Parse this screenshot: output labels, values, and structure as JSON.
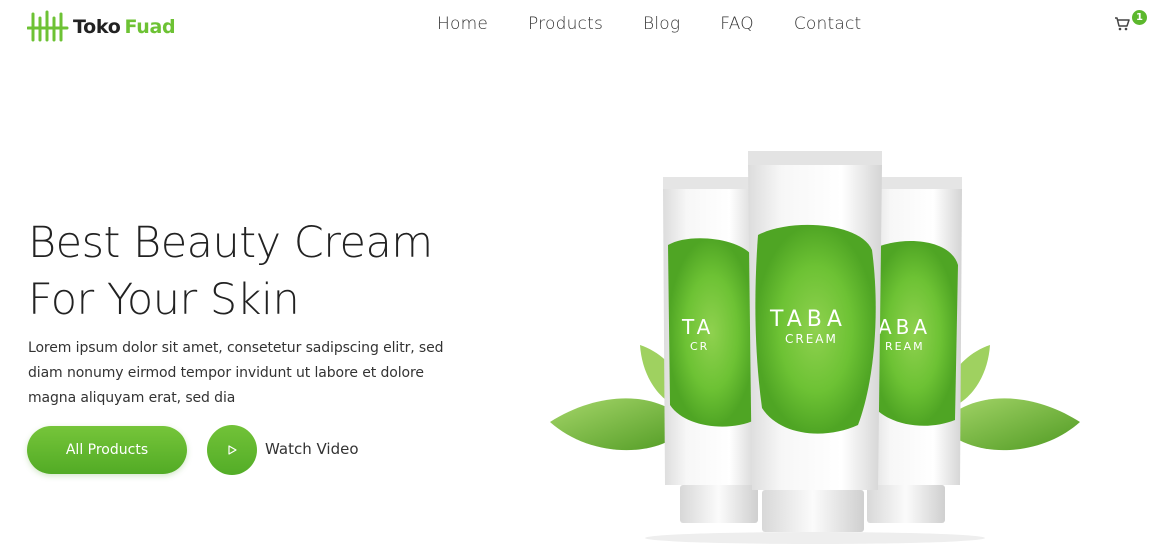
{
  "header": {
    "logo": {
      "part1": "Toko",
      "part2": "Fuad",
      "icon": "bars-logo-icon"
    },
    "nav": [
      {
        "label": "Home"
      },
      {
        "label": "Products"
      },
      {
        "label": "Blog"
      },
      {
        "label": "FAQ"
      },
      {
        "label": "Contact"
      }
    ],
    "cart": {
      "icon": "cart-icon",
      "count": "1"
    }
  },
  "hero": {
    "title_line1": "Best Beauty Cream",
    "title_line2": "For Your Skin",
    "description": "Lorem ipsum dolor sit amet, consetetur sadipscing elitr, sed diam nonumy eirmod tempor invidunt ut labore et dolore magna aliquyam erat, sed dia",
    "primary_button": "All Products",
    "video_button": {
      "icon": "play-icon",
      "label": "Watch Video"
    }
  },
  "product_image": {
    "brand": "TABA",
    "sub": "CREAM"
  },
  "colors": {
    "accent": "#6dc234",
    "accent_dark": "#52ab25",
    "text": "#222222"
  }
}
